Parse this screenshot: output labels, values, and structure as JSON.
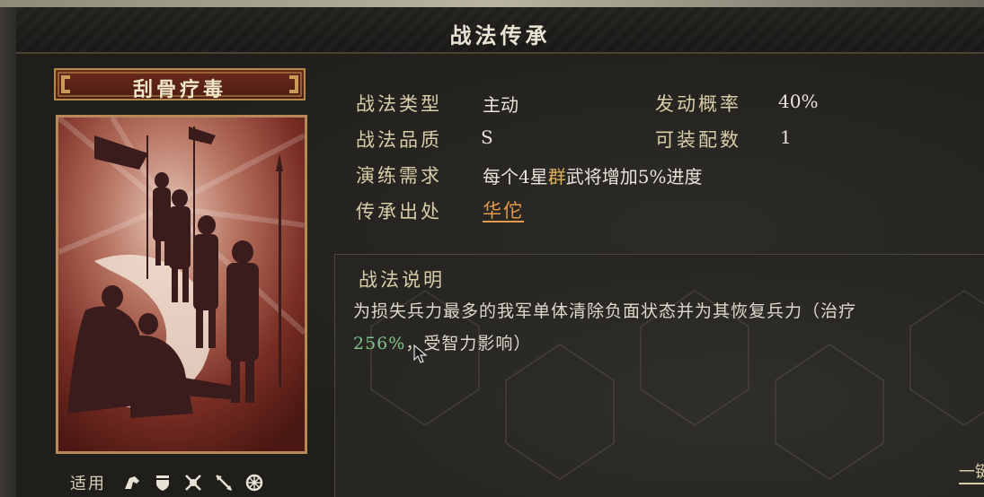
{
  "window": {
    "title": "战法传承"
  },
  "skill": {
    "name": "刮骨疗毒",
    "art_icon": "surgery-scene-illustration"
  },
  "info": {
    "type_label": "战法类型",
    "type_value": "主动",
    "rate_label": "发动概率",
    "rate_value": "40%",
    "quality_label": "战法品质",
    "quality_value": "S",
    "equip_label": "可装配数",
    "equip_value": "1",
    "drill_label": "演练需求",
    "drill_prefix": "每个4星",
    "drill_faction": "群",
    "drill_suffix": "武将增加5%进度",
    "source_label": "传承出处",
    "source_value": "华佗"
  },
  "description": {
    "title": "战法说明",
    "line1": "为损失兵力最多的我军单体清除负面状态并为其恢复兵力（治疗",
    "pct": "256%",
    "line2_rest": "，受智力影响）",
    "corner_text": "一键"
  },
  "applicable": {
    "label": "适用",
    "icons": [
      "cavalry-icon",
      "shield-icon",
      "crossed-bows-icon",
      "spear-icon",
      "wheel-icon"
    ]
  },
  "colors": {
    "accent_gold": "#d8cda8",
    "faction": "#e0b25a",
    "link": "#e39a4a",
    "percent": "#7fc48a",
    "plate_red": "#6a2a1b"
  }
}
